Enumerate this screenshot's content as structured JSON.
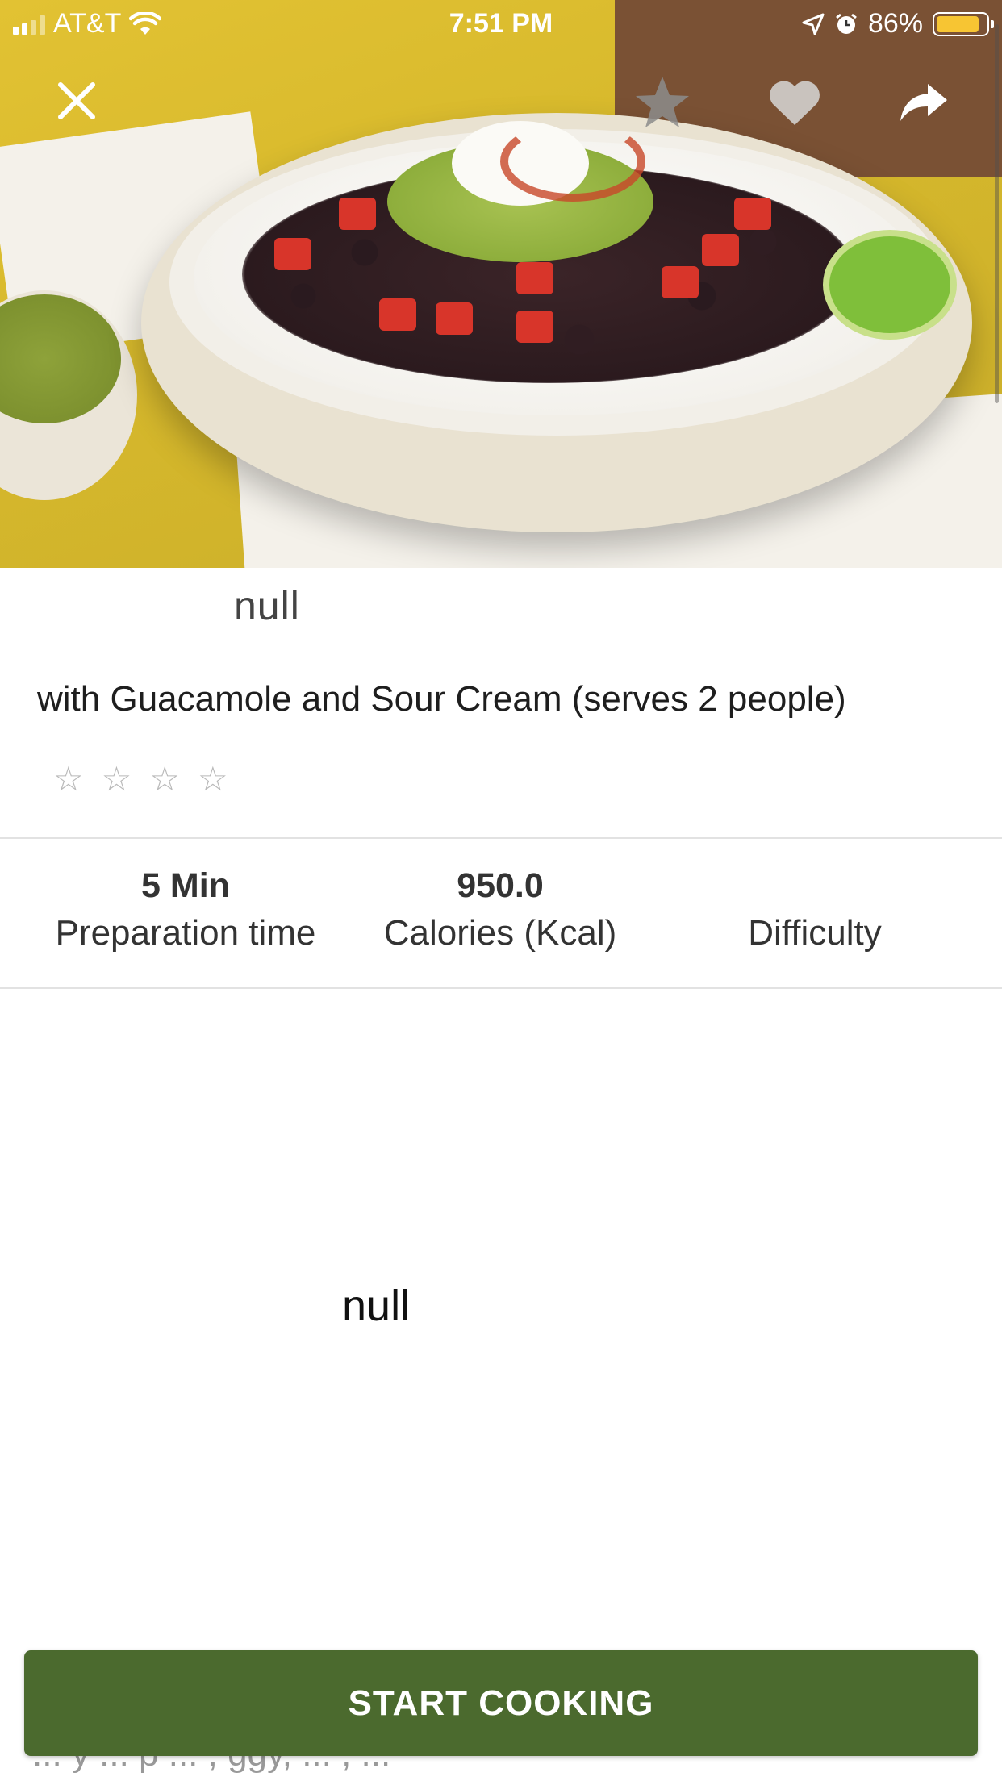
{
  "status_bar": {
    "carrier": "AT&T",
    "time": "7:51 PM",
    "battery_percent_label": "86%",
    "battery_level": 0.86,
    "battery_color": "#f7c533"
  },
  "hero": {
    "icons": [
      "close-icon",
      "star-icon",
      "heart-icon",
      "share-icon"
    ]
  },
  "recipe": {
    "title": "null",
    "subtitle": "with Guacamole and Sour Cream (serves 2 people)",
    "rating_stars": [
      "☆",
      "☆",
      "☆",
      "☆"
    ],
    "rating_value": 0
  },
  "stats": {
    "prep_value": "5 Min",
    "prep_label": "Preparation time",
    "calories_value": "950.0",
    "calories_label": "Calories (Kcal)",
    "difficulty_value": "",
    "difficulty_label": "Difficulty"
  },
  "content": {
    "heading": "null",
    "partial_text": "... y ... p ... , ggy, ... , ..."
  },
  "actions": {
    "start_label": "START COOKING",
    "start_color": "#4b6a2e"
  }
}
